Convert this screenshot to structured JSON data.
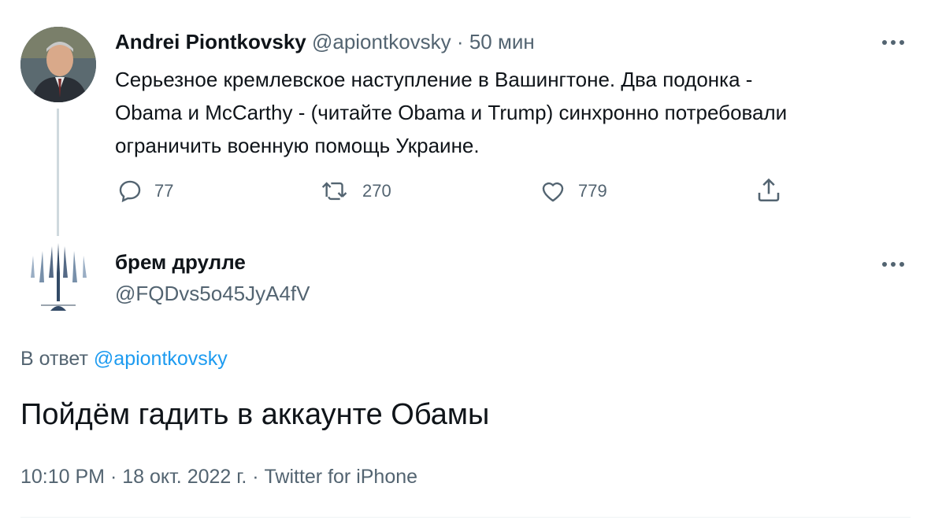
{
  "original_tweet": {
    "display_name": "Andrei Piontkovsky",
    "handle": "@apiontkovsky",
    "separator": "·",
    "time_ago": "50 мин",
    "text_lines": [
      "Серьезное кремлевское наступление в Вашингтоне. Два подонка -",
      "Obama и McCarthy - (читайте Obama и Trump) синхронно потребовали",
      "ограничить военную помощь Украине."
    ],
    "actions": {
      "replies": "77",
      "retweets": "270",
      "likes": "779"
    }
  },
  "reply_tweet": {
    "display_name": "брем друлле",
    "handle": "@FQDvs5o45JyA4fV",
    "replying_to_prefix": "В ответ",
    "replying_to_handle": "@apiontkovsky",
    "text": "Пойдём гадить в аккаунте Обамы",
    "time": "10:10 PM",
    "date": "18 окт. 2022 г.",
    "source": "Twitter for iPhone",
    "sep": "·"
  },
  "icons": [
    "reply-icon",
    "retweet-icon",
    "like-icon",
    "share-icon",
    "more-icon"
  ],
  "colors": {
    "link": "#1d9bf0",
    "muted": "#536471",
    "text": "#0f1419"
  }
}
